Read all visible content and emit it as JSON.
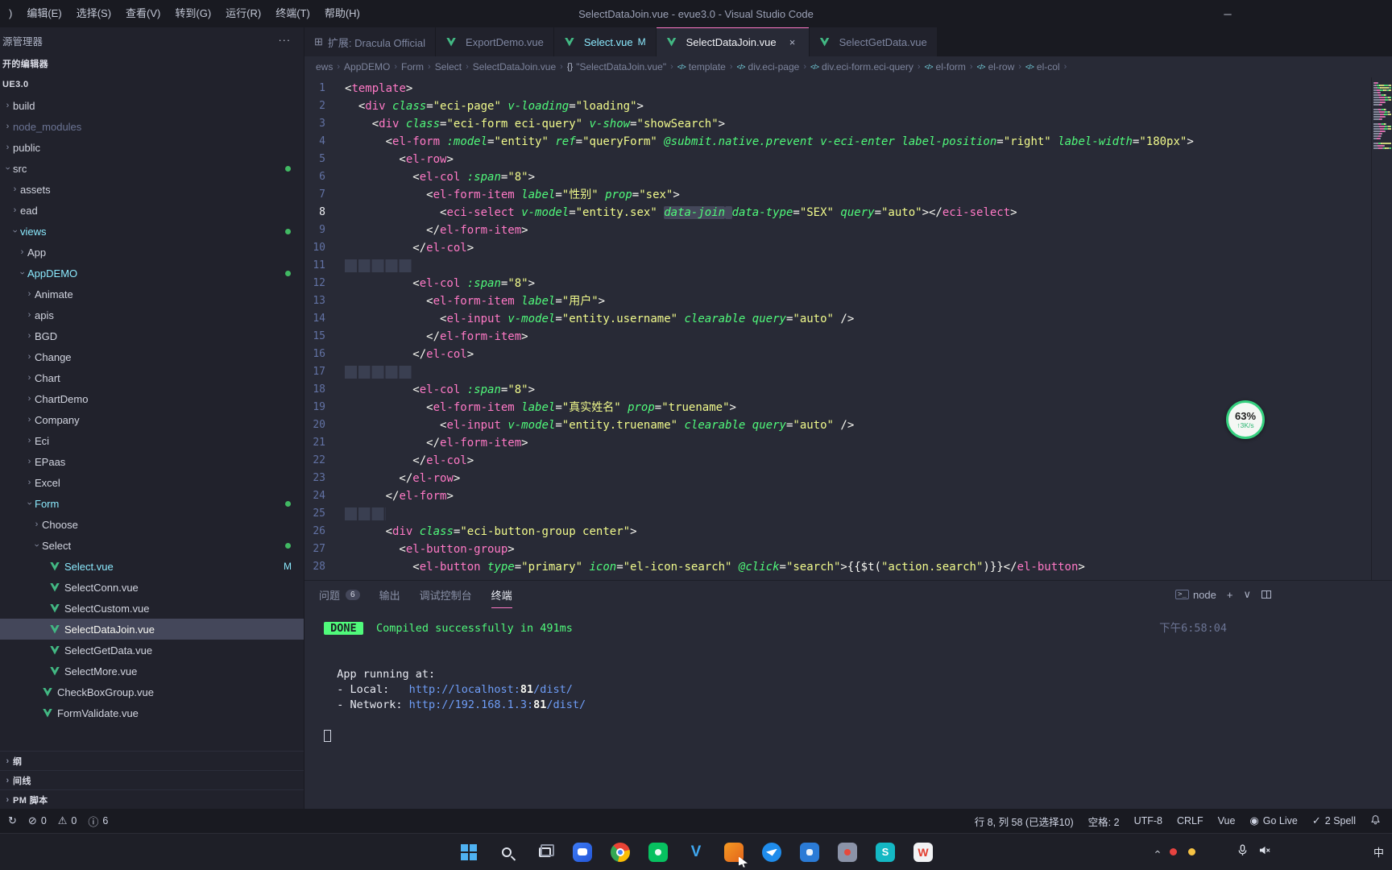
{
  "window": {
    "title": "SelectDataJoin.vue - evue3.0 - Visual Studio Code",
    "minimize_glyph": "─"
  },
  "menu": {
    "items": [
      ")",
      "编辑(E)",
      "选择(S)",
      "查看(V)",
      "转到(G)",
      "运行(R)",
      "终端(T)",
      "帮助(H)"
    ]
  },
  "sidebar": {
    "title": "源管理器",
    "more_actions": "···",
    "open_editors_label": "开的编辑器",
    "workspace_label": "UE3.0",
    "tree": [
      {
        "label": "build",
        "level": 0,
        "kind": "folder",
        "state": "collapsed"
      },
      {
        "label": "node_modules",
        "level": 0,
        "kind": "folder",
        "state": "collapsed",
        "color": "dim"
      },
      {
        "label": "public",
        "level": 0,
        "kind": "folder",
        "state": "collapsed"
      },
      {
        "label": "src",
        "level": 0,
        "kind": "folder",
        "state": "expanded",
        "dot": true
      },
      {
        "label": "assets",
        "level": 1,
        "kind": "folder",
        "state": "collapsed"
      },
      {
        "label": "ead",
        "level": 1,
        "kind": "folder",
        "state": "collapsed"
      },
      {
        "label": "views",
        "level": 1,
        "kind": "folder",
        "state": "expanded",
        "color": "cyan",
        "dot": true
      },
      {
        "label": "App",
        "level": 2,
        "kind": "folder",
        "state": "collapsed"
      },
      {
        "label": "AppDEMO",
        "level": 2,
        "kind": "folder",
        "state": "expanded",
        "color": "cyan",
        "dot": true
      },
      {
        "label": "Animate",
        "level": 3,
        "kind": "folder",
        "state": "collapsed"
      },
      {
        "label": "apis",
        "level": 3,
        "kind": "folder",
        "state": "collapsed"
      },
      {
        "label": "BGD",
        "level": 3,
        "kind": "folder",
        "state": "collapsed"
      },
      {
        "label": "Change",
        "level": 3,
        "kind": "folder",
        "state": "collapsed"
      },
      {
        "label": "Chart",
        "level": 3,
        "kind": "folder",
        "state": "collapsed"
      },
      {
        "label": "ChartDemo",
        "level": 3,
        "kind": "folder",
        "state": "collapsed"
      },
      {
        "label": "Company",
        "level": 3,
        "kind": "folder",
        "state": "collapsed"
      },
      {
        "label": "Eci",
        "level": 3,
        "kind": "folder",
        "state": "collapsed"
      },
      {
        "label": "EPaas",
        "level": 3,
        "kind": "folder",
        "state": "collapsed"
      },
      {
        "label": "Excel",
        "level": 3,
        "kind": "folder",
        "state": "collapsed"
      },
      {
        "label": "Form",
        "level": 3,
        "kind": "folder",
        "state": "expanded",
        "color": "cyan",
        "dot": true
      },
      {
        "label": "Choose",
        "level": 4,
        "kind": "folder",
        "state": "collapsed"
      },
      {
        "label": "Select",
        "level": 4,
        "kind": "folder",
        "state": "expanded",
        "dot": true
      },
      {
        "label": "Select.vue",
        "level": 5,
        "kind": "vue",
        "color": "cyan",
        "badge": "M"
      },
      {
        "label": "SelectConn.vue",
        "level": 5,
        "kind": "vue"
      },
      {
        "label": "SelectCustom.vue",
        "level": 5,
        "kind": "vue"
      },
      {
        "label": "SelectDataJoin.vue",
        "level": 5,
        "kind": "vue",
        "selected": true
      },
      {
        "label": "SelectGetData.vue",
        "level": 5,
        "kind": "vue"
      },
      {
        "label": "SelectMore.vue",
        "level": 5,
        "kind": "vue"
      },
      {
        "label": "CheckBoxGroup.vue",
        "level": 4,
        "kind": "vue"
      },
      {
        "label": "FormValidate.vue",
        "level": 4,
        "kind": "vue"
      }
    ],
    "bottom_sections": [
      "纲",
      "间线",
      "PM 脚本"
    ]
  },
  "tabs": [
    {
      "label": "扩展: Dracula Official",
      "icon": "extension"
    },
    {
      "label": "ExportDemo.vue",
      "icon": "vue"
    },
    {
      "label": "Select.vue",
      "icon": "vue",
      "badge": "M",
      "color": "cyan"
    },
    {
      "label": "SelectDataJoin.vue",
      "icon": "vue",
      "active": true,
      "close": "×"
    },
    {
      "label": "SelectGetData.vue",
      "icon": "vue"
    }
  ],
  "breadcrumbs": [
    {
      "label": "ews"
    },
    {
      "label": "AppDEMO"
    },
    {
      "label": "Form"
    },
    {
      "label": "Select"
    },
    {
      "label": "SelectDataJoin.vue"
    },
    {
      "label": "\"SelectDataJoin.vue\"",
      "icon": "braces"
    },
    {
      "label": "template",
      "icon": "tag"
    },
    {
      "label": "div.eci-page",
      "icon": "tag"
    },
    {
      "label": "div.eci-form.eci-query",
      "icon": "tag"
    },
    {
      "label": "el-form",
      "icon": "tag"
    },
    {
      "label": "el-row",
      "icon": "tag"
    },
    {
      "label": "el-col",
      "icon": "tag"
    }
  ],
  "editor": {
    "active_line": 8,
    "lines": [
      [
        [
          "p",
          "<"
        ],
        [
          "t",
          "template"
        ],
        [
          "p",
          ">"
        ]
      ],
      [
        [
          "p",
          "  <"
        ],
        [
          "t",
          "div"
        ],
        [
          "p",
          " "
        ],
        [
          "a",
          "class"
        ],
        [
          "p",
          "="
        ],
        [
          "s",
          "\"eci-page\""
        ],
        [
          "p",
          " "
        ],
        [
          "a",
          "v-loading"
        ],
        [
          "p",
          "="
        ],
        [
          "s",
          "\"loading\""
        ],
        [
          "p",
          ">"
        ]
      ],
      [
        [
          "p",
          "    <"
        ],
        [
          "t",
          "div"
        ],
        [
          "p",
          " "
        ],
        [
          "a",
          "class"
        ],
        [
          "p",
          "="
        ],
        [
          "s",
          "\"eci-form eci-query\""
        ],
        [
          "p",
          " "
        ],
        [
          "a",
          "v-show"
        ],
        [
          "p",
          "="
        ],
        [
          "s",
          "\"showSearch\""
        ],
        [
          "p",
          ">"
        ]
      ],
      [
        [
          "p",
          "      <"
        ],
        [
          "t",
          "el-form"
        ],
        [
          "p",
          " "
        ],
        [
          "a",
          ":model"
        ],
        [
          "p",
          "="
        ],
        [
          "s",
          "\"entity\""
        ],
        [
          "p",
          " "
        ],
        [
          "a",
          "ref"
        ],
        [
          "p",
          "="
        ],
        [
          "s",
          "\"queryForm\""
        ],
        [
          "p",
          " "
        ],
        [
          "a",
          "@submit.native.prevent"
        ],
        [
          "p",
          " "
        ],
        [
          "a",
          "v-eci-enter"
        ],
        [
          "p",
          " "
        ],
        [
          "a",
          "label-position"
        ],
        [
          "p",
          "="
        ],
        [
          "s",
          "\"right\""
        ],
        [
          "p",
          " "
        ],
        [
          "a",
          "label-width"
        ],
        [
          "p",
          "="
        ],
        [
          "s",
          "\"180px\""
        ],
        [
          "p",
          ">"
        ]
      ],
      [
        [
          "p",
          "        <"
        ],
        [
          "t",
          "el-row"
        ],
        [
          "p",
          ">"
        ]
      ],
      [
        [
          "p",
          "          <"
        ],
        [
          "t",
          "el-col"
        ],
        [
          "p",
          " "
        ],
        [
          "a",
          ":span"
        ],
        [
          "p",
          "="
        ],
        [
          "s",
          "\"8\""
        ],
        [
          "p",
          ">"
        ]
      ],
      [
        [
          "p",
          "            <"
        ],
        [
          "t",
          "el-form-item"
        ],
        [
          "p",
          " "
        ],
        [
          "a",
          "label"
        ],
        [
          "p",
          "="
        ],
        [
          "s",
          "\"性别\""
        ],
        [
          "p",
          " "
        ],
        [
          "a",
          "prop"
        ],
        [
          "p",
          "="
        ],
        [
          "s",
          "\"sex\""
        ],
        [
          "p",
          ">"
        ]
      ],
      [
        [
          "p",
          "              <"
        ],
        [
          "t",
          "eci-select"
        ],
        [
          "p",
          " "
        ],
        [
          "a",
          "v-model"
        ],
        [
          "p",
          "="
        ],
        [
          "s",
          "\"entity.sex\""
        ],
        [
          "p",
          " "
        ],
        [
          "a",
          "data-join",
          1
        ],
        [
          "p",
          " ",
          1
        ],
        [
          "a",
          "data-type"
        ],
        [
          "p",
          "="
        ],
        [
          "s",
          "\"SEX\""
        ],
        [
          "p",
          " "
        ],
        [
          "a",
          "query"
        ],
        [
          "p",
          "="
        ],
        [
          "s",
          "\"auto\""
        ],
        [
          "p",
          "></"
        ],
        [
          "t",
          "eci-select"
        ],
        [
          "p",
          ">"
        ]
      ],
      [
        [
          "p",
          "            </"
        ],
        [
          "t",
          "el-form-item"
        ],
        [
          "p",
          ">"
        ]
      ],
      [
        [
          "p",
          "          </"
        ],
        [
          "t",
          "el-col"
        ],
        [
          "p",
          ">"
        ]
      ],
      [
        [
          "w",
          "          "
        ]
      ],
      [
        [
          "p",
          "          <"
        ],
        [
          "t",
          "el-col"
        ],
        [
          "p",
          " "
        ],
        [
          "a",
          ":span"
        ],
        [
          "p",
          "="
        ],
        [
          "s",
          "\"8\""
        ],
        [
          "p",
          ">"
        ]
      ],
      [
        [
          "p",
          "            <"
        ],
        [
          "t",
          "el-form-item"
        ],
        [
          "p",
          " "
        ],
        [
          "a",
          "label"
        ],
        [
          "p",
          "="
        ],
        [
          "s",
          "\"用户\""
        ],
        [
          "p",
          ">"
        ]
      ],
      [
        [
          "p",
          "              <"
        ],
        [
          "t",
          "el-input"
        ],
        [
          "p",
          " "
        ],
        [
          "a",
          "v-model"
        ],
        [
          "p",
          "="
        ],
        [
          "s",
          "\"entity.username\""
        ],
        [
          "p",
          " "
        ],
        [
          "a",
          "clearable"
        ],
        [
          "p",
          " "
        ],
        [
          "a",
          "query"
        ],
        [
          "p",
          "="
        ],
        [
          "s",
          "\"auto\""
        ],
        [
          "p",
          " />"
        ]
      ],
      [
        [
          "p",
          "            </"
        ],
        [
          "t",
          "el-form-item"
        ],
        [
          "p",
          ">"
        ]
      ],
      [
        [
          "p",
          "          </"
        ],
        [
          "t",
          "el-col"
        ],
        [
          "p",
          ">"
        ]
      ],
      [
        [
          "w",
          "          "
        ]
      ],
      [
        [
          "p",
          "          <"
        ],
        [
          "t",
          "el-col"
        ],
        [
          "p",
          " "
        ],
        [
          "a",
          ":span"
        ],
        [
          "p",
          "="
        ],
        [
          "s",
          "\"8\""
        ],
        [
          "p",
          ">"
        ]
      ],
      [
        [
          "p",
          "            <"
        ],
        [
          "t",
          "el-form-item"
        ],
        [
          "p",
          " "
        ],
        [
          "a",
          "label"
        ],
        [
          "p",
          "="
        ],
        [
          "s",
          "\"真实姓名\""
        ],
        [
          "p",
          " "
        ],
        [
          "a",
          "prop"
        ],
        [
          "p",
          "="
        ],
        [
          "s",
          "\"truename\""
        ],
        [
          "p",
          ">"
        ]
      ],
      [
        [
          "p",
          "              <"
        ],
        [
          "t",
          "el-input"
        ],
        [
          "p",
          " "
        ],
        [
          "a",
          "v-model"
        ],
        [
          "p",
          "="
        ],
        [
          "s",
          "\"entity.truename\""
        ],
        [
          "p",
          " "
        ],
        [
          "a",
          "clearable"
        ],
        [
          "p",
          " "
        ],
        [
          "a",
          "query"
        ],
        [
          "p",
          "="
        ],
        [
          "s",
          "\"auto\""
        ],
        [
          "p",
          " />"
        ]
      ],
      [
        [
          "p",
          "            </"
        ],
        [
          "t",
          "el-form-item"
        ],
        [
          "p",
          ">"
        ]
      ],
      [
        [
          "p",
          "          </"
        ],
        [
          "t",
          "el-col"
        ],
        [
          "p",
          ">"
        ]
      ],
      [
        [
          "p",
          "        </"
        ],
        [
          "t",
          "el-row"
        ],
        [
          "p",
          ">"
        ]
      ],
      [
        [
          "p",
          "      </"
        ],
        [
          "t",
          "el-form"
        ],
        [
          "p",
          ">"
        ]
      ],
      [
        [
          "w",
          "      "
        ]
      ],
      [
        [
          "p",
          "      <"
        ],
        [
          "t",
          "div"
        ],
        [
          "p",
          " "
        ],
        [
          "a",
          "class"
        ],
        [
          "p",
          "="
        ],
        [
          "s",
          "\"eci-button-group center\""
        ],
        [
          "p",
          ">"
        ]
      ],
      [
        [
          "p",
          "        <"
        ],
        [
          "t",
          "el-button-group"
        ],
        [
          "p",
          ">"
        ]
      ],
      [
        [
          "p",
          "          <"
        ],
        [
          "t",
          "el-button"
        ],
        [
          "p",
          " "
        ],
        [
          "a",
          "type"
        ],
        [
          "p",
          "="
        ],
        [
          "s",
          "\"primary\""
        ],
        [
          "p",
          " "
        ],
        [
          "a",
          "icon"
        ],
        [
          "p",
          "="
        ],
        [
          "s",
          "\"el-icon-search\""
        ],
        [
          "p",
          " "
        ],
        [
          "a",
          "@click"
        ],
        [
          "p",
          "="
        ],
        [
          "s",
          "\"search\""
        ],
        [
          "p",
          ">{{$t("
        ],
        [
          "s",
          "\"action.search\""
        ],
        [
          "p",
          ")}}</"
        ],
        [
          "t",
          "el-button"
        ],
        [
          "p",
          ">"
        ]
      ]
    ]
  },
  "panel": {
    "tabs": [
      {
        "label": "问题",
        "badge": "6"
      },
      {
        "label": "输出"
      },
      {
        "label": "调试控制台"
      },
      {
        "label": "终端",
        "active": true
      }
    ],
    "actions": [
      {
        "name": "terminal-shell-select",
        "icon": "terminal-icon",
        "label": "node"
      },
      {
        "name": "new-terminal-button",
        "glyph": "+"
      },
      {
        "name": "terminal-dropdown-button",
        "glyph": "∨"
      },
      {
        "name": "split-terminal-button",
        "icon": "split-icon"
      }
    ],
    "clock": "下午6:58:04",
    "terminal": [
      [
        [
          "badge",
          " DONE "
        ],
        [
          "ok",
          "  Compiled successfully in 491ms"
        ]
      ],
      [],
      [],
      [
        [
          "fg",
          "  App running at:"
        ]
      ],
      [
        [
          "fg",
          "  - Local:   "
        ],
        [
          "url",
          "http://localhost:"
        ],
        [
          "port",
          "81"
        ],
        [
          "url",
          "/dist/"
        ]
      ],
      [
        [
          "fg",
          "  - Network: "
        ],
        [
          "url",
          "http://192.168.1.3:"
        ],
        [
          "port",
          "81"
        ],
        [
          "url",
          "/dist/"
        ]
      ],
      [],
      [
        [
          "cursor",
          ""
        ]
      ]
    ]
  },
  "status": {
    "left": [
      {
        "icon": "sync-icon",
        "label": ""
      },
      {
        "icon": "error-icon",
        "label": "0"
      },
      {
        "icon": "warning-icon",
        "label": "0"
      },
      {
        "icon": "info-icon",
        "label": "6"
      }
    ],
    "right": [
      {
        "label": "行 8, 列 58 (已选择10)"
      },
      {
        "label": "空格: 2"
      },
      {
        "label": "UTF-8"
      },
      {
        "label": "CRLF"
      },
      {
        "label": "Vue"
      },
      {
        "icon": "broadcast-icon",
        "label": "Go Live"
      },
      {
        "icon": "check-icon",
        "label": "2 Spell"
      },
      {
        "icon": "bell-icon",
        "label": ""
      }
    ]
  },
  "taskbar": {
    "buttons": [
      "start",
      "search",
      "task-view",
      "chat",
      "chrome",
      "wechat-devtools",
      "vscode",
      "capture-tool",
      "dingtalk",
      "app-blue",
      "app-grey",
      "app-teal",
      "wps"
    ],
    "tray": [
      "tray-expand",
      "tray-red-dot",
      "tray-yellow-dot",
      "microphone",
      "speaker-muted"
    ],
    "ime_label": "中"
  },
  "overlay": {
    "percent": "63%",
    "speed": "3K/s"
  },
  "colors": {
    "bg": "#282a36",
    "bg_dark": "#21222c",
    "bg_darker": "#191a21",
    "selection": "#44475a",
    "comment": "#6272a4",
    "fg": "#f8f8f2",
    "pink": "#ff79c6",
    "green": "#50fa7b",
    "yellow": "#f1fa8c",
    "cyan": "#8be9fd",
    "purple": "#bd93f9",
    "vue_green": "#42b883"
  }
}
